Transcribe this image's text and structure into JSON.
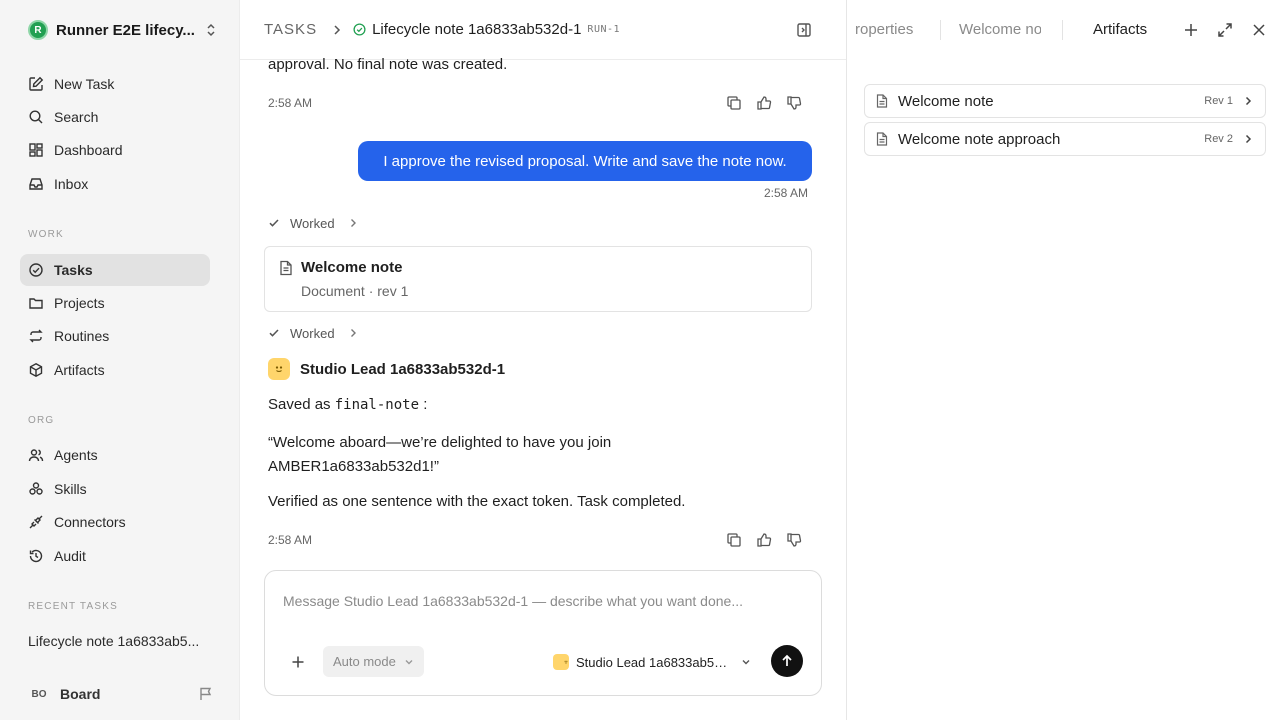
{
  "workspace": {
    "logo": "R",
    "name": "Runner E2E lifecy..."
  },
  "nav_top": [
    {
      "label": "New Task",
      "icon": "edit-icon"
    },
    {
      "label": "Search",
      "icon": "search-icon"
    },
    {
      "label": "Dashboard",
      "icon": "dashboard-icon"
    },
    {
      "label": "Inbox",
      "icon": "inbox-icon"
    }
  ],
  "sections": {
    "work": "WORK",
    "org": "ORG",
    "recent": "RECENT TASKS"
  },
  "nav_work": [
    {
      "label": "Tasks",
      "icon": "check-circle-icon",
      "active": true
    },
    {
      "label": "Projects",
      "icon": "folder-icon"
    },
    {
      "label": "Routines",
      "icon": "repeat-icon"
    },
    {
      "label": "Artifacts",
      "icon": "box-icon"
    }
  ],
  "nav_org": [
    {
      "label": "Agents",
      "icon": "users-icon"
    },
    {
      "label": "Skills",
      "icon": "skills-icon"
    },
    {
      "label": "Connectors",
      "icon": "plug-icon"
    },
    {
      "label": "Audit",
      "icon": "history-icon"
    }
  ],
  "recent_tasks": [
    "Lifecycle note 1a6833ab5..."
  ],
  "board": {
    "initials": "BO",
    "label": "Board"
  },
  "header": {
    "section": "TASKS",
    "title": "Lifecycle note 1a6833ab532d-1",
    "run": "RUN-1"
  },
  "conversation": {
    "prev_text": "approval. No final note was created.",
    "prev_time": "2:58 AM",
    "user_message": "I approve the revised proposal. Write and save the note now.",
    "user_time": "2:58 AM",
    "worked_label": "Worked",
    "doc_card": {
      "title": "Welcome note",
      "meta": "Document · rev 1"
    },
    "agent_name": "Studio Lead 1a6833ab532d-1",
    "saved_prefix": "Saved as",
    "saved_code": "final-note",
    "saved_suffix": ":",
    "quote_line1": "“Welcome aboard—we’re delighted to have you join",
    "quote_line2": "AMBER1a6833ab532d1!”",
    "verified": "Verified as one sentence with the exact token. Task completed.",
    "agent_time": "2:58 AM"
  },
  "composer": {
    "placeholder": "Message Studio Lead 1a6833ab532d-1 — describe what you want done...",
    "mode": "Auto mode",
    "agent": "Studio Lead 1a6833ab53..."
  },
  "right_panel": {
    "tabs": [
      "roperties",
      "Welcome no",
      "Artifacts"
    ],
    "artifacts": [
      {
        "name": "Welcome note",
        "rev": "Rev 1"
      },
      {
        "name": "Welcome note approach",
        "rev": "Rev 2"
      }
    ]
  }
}
